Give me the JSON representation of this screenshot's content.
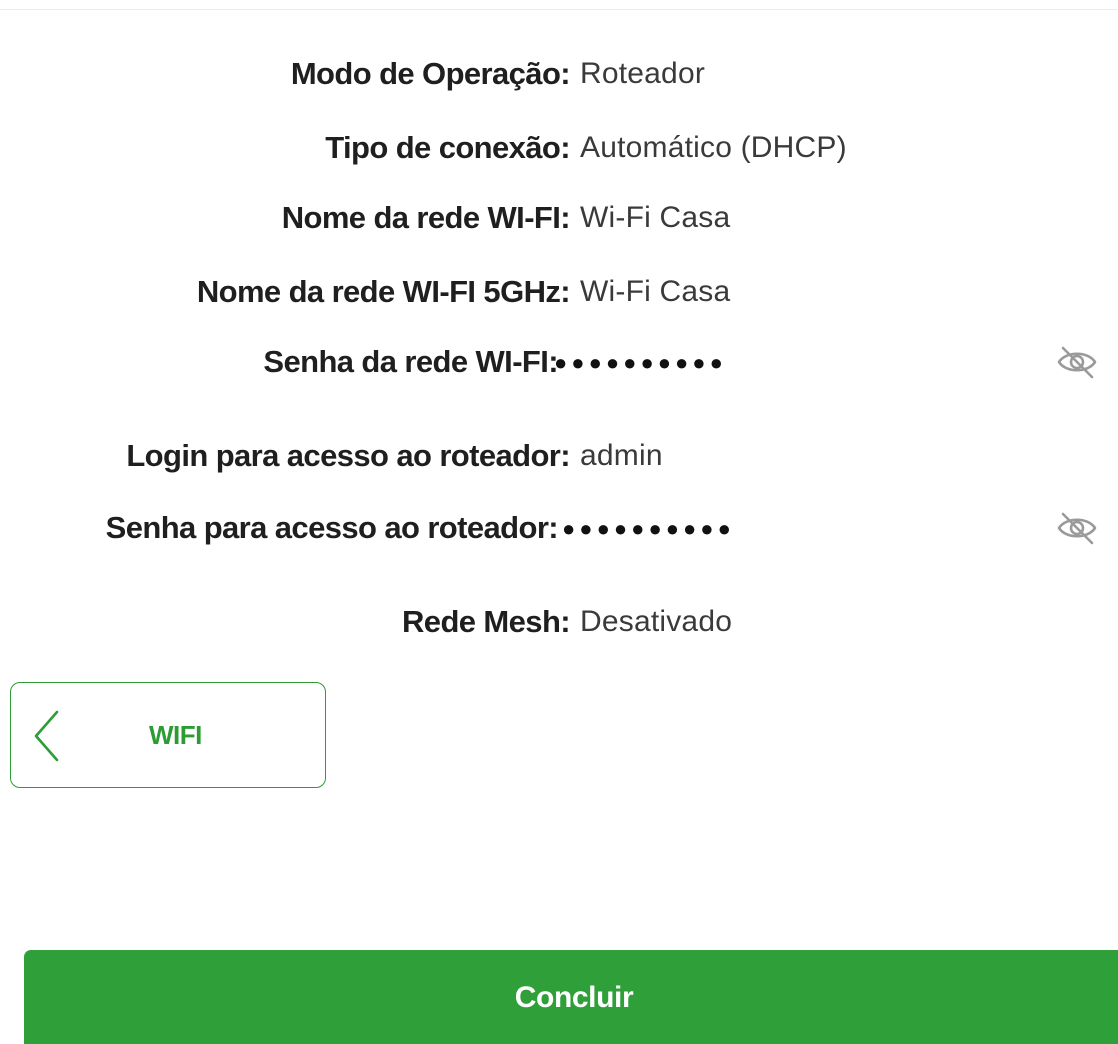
{
  "summary": {
    "operation_mode": {
      "label": "Modo de Operação:",
      "value": "Roteador"
    },
    "connection_type": {
      "label": "Tipo de conexão:",
      "value": "Automático (DHCP)"
    },
    "wifi_name": {
      "label": "Nome da rede WI-FI:",
      "value": "Wi-Fi Casa"
    },
    "wifi_5ghz_name": {
      "label": "Nome da rede WI-FI 5GHz:",
      "value": "Wi-Fi Casa"
    },
    "wifi_password": {
      "label": "Senha da rede WI-FI:",
      "value": "●●●●●●●●●●",
      "toggle_icon": "eye-off-icon"
    },
    "router_login": {
      "label": "Login para acesso ao roteador:",
      "value": "admin"
    },
    "router_password": {
      "label": "Senha para acesso ao roteador:",
      "value": "●●●●●●●●●●",
      "toggle_icon": "eye-off-icon"
    },
    "mesh_network": {
      "label": "Rede Mesh:",
      "value": "Desativado"
    }
  },
  "back_button": {
    "label": "WIFI",
    "icon": "chevron-left-icon"
  },
  "finish_button": {
    "label": "Concluir"
  },
  "colors": {
    "primary_green": "#2f9f39",
    "outline_green": "#2e9c35",
    "icon_gray": "#9a9a9a"
  }
}
